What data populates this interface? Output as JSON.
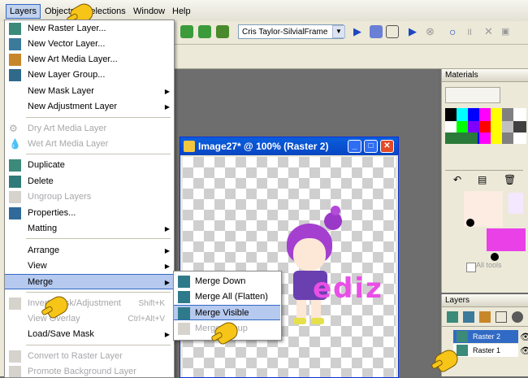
{
  "menubar": {
    "items": [
      "Layers",
      "Objects",
      "Selections",
      "Window",
      "Help"
    ]
  },
  "toolbar": {
    "preset_select": "Cris Taylor-SilvialFrame"
  },
  "image_window": {
    "title": "Image27* @ 100% (Raster 2)",
    "canvas_text": "ediz"
  },
  "materials_panel": {
    "title": "Materials",
    "all_tools_label": "All tools"
  },
  "layers_panel": {
    "title": "Layers",
    "layers": [
      "Raster 2",
      "Raster 1"
    ]
  },
  "layers_menu": {
    "items": [
      {
        "label": "New Raster Layer...",
        "enabled": true,
        "submenu": false,
        "shortcut": ""
      },
      {
        "label": "New Vector Layer...",
        "enabled": true,
        "submenu": false,
        "shortcut": ""
      },
      {
        "label": "New Art Media Layer...",
        "enabled": true,
        "submenu": false,
        "shortcut": ""
      },
      {
        "label": "New Layer Group...",
        "enabled": true,
        "submenu": false,
        "shortcut": ""
      },
      {
        "label": "New Mask Layer",
        "enabled": true,
        "submenu": true,
        "shortcut": ""
      },
      {
        "label": "New Adjustment Layer",
        "enabled": true,
        "submenu": true,
        "shortcut": ""
      },
      {
        "label": "Dry Art Media Layer",
        "enabled": false,
        "submenu": false,
        "shortcut": ""
      },
      {
        "label": "Wet Art Media Layer",
        "enabled": false,
        "submenu": false,
        "shortcut": ""
      },
      {
        "label": "Duplicate",
        "enabled": true,
        "submenu": false,
        "shortcut": ""
      },
      {
        "label": "Delete",
        "enabled": true,
        "submenu": false,
        "shortcut": ""
      },
      {
        "label": "Ungroup Layers",
        "enabled": false,
        "submenu": false,
        "shortcut": ""
      },
      {
        "label": "Properties...",
        "enabled": true,
        "submenu": false,
        "shortcut": ""
      },
      {
        "label": "Matting",
        "enabled": true,
        "submenu": true,
        "shortcut": ""
      },
      {
        "label": "Arrange",
        "enabled": true,
        "submenu": true,
        "shortcut": ""
      },
      {
        "label": "View",
        "enabled": true,
        "submenu": true,
        "shortcut": ""
      },
      {
        "label": "Merge",
        "enabled": true,
        "submenu": true,
        "shortcut": ""
      },
      {
        "label": "Invert Mask/Adjustment",
        "enabled": false,
        "submenu": false,
        "shortcut": "Shift+K"
      },
      {
        "label": "View Overlay",
        "enabled": false,
        "submenu": false,
        "shortcut": "Ctrl+Alt+V"
      },
      {
        "label": "Load/Save Mask",
        "enabled": true,
        "submenu": true,
        "shortcut": ""
      },
      {
        "label": "Convert to Raster Layer",
        "enabled": false,
        "submenu": false,
        "shortcut": ""
      },
      {
        "label": "Promote Background Layer",
        "enabled": false,
        "submenu": false,
        "shortcut": ""
      }
    ]
  },
  "merge_submenu": {
    "items": [
      {
        "label": "Merge Down",
        "enabled": true
      },
      {
        "label": "Merge All (Flatten)",
        "enabled": true
      },
      {
        "label": "Merge Visible",
        "enabled": true
      },
      {
        "label": "Merge Group",
        "enabled": false
      }
    ]
  }
}
